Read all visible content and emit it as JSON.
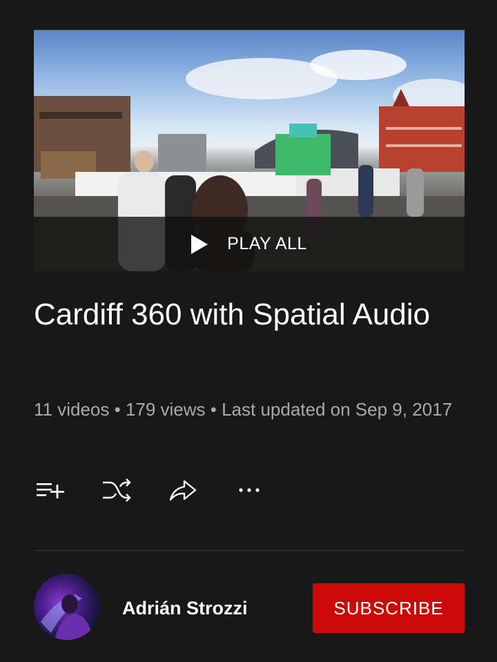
{
  "playlist": {
    "thumbnail_alt": "Cardiff Bay 360 street scene",
    "play_all_label": "PLAY ALL",
    "title": "Cardiff 360 with Spatial Audio",
    "meta": "11 videos • 179 views • Last updated on Sep 9, 2017"
  },
  "actions": [
    {
      "name": "save-to-playlist",
      "icon": "playlist-add-icon"
    },
    {
      "name": "shuffle",
      "icon": "shuffle-icon"
    },
    {
      "name": "share",
      "icon": "share-icon"
    },
    {
      "name": "more",
      "icon": "more-horizontal-icon"
    }
  ],
  "channel": {
    "name": "Adrián Strozzi",
    "subscribe_label": "SUBSCRIBE"
  },
  "colors": {
    "background": "#181818",
    "subscribe": "#cc0a0a",
    "meta_text": "#aaaaaa"
  }
}
